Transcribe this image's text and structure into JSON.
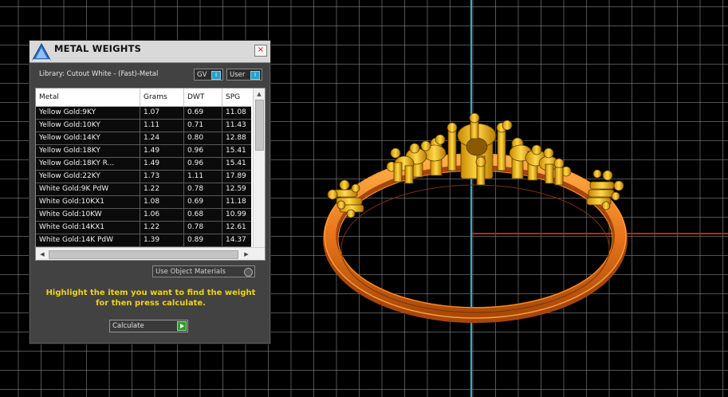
{
  "dialog": {
    "title": "METAL WEIGHTS",
    "close_glyph": "×",
    "library_label": "Library: Cutout White - (Fast)-Metal",
    "gv_label": "GV",
    "user_label": "User",
    "toggle_glyph": "I",
    "table": {
      "columns": [
        "Metal",
        "Grams",
        "DWT",
        "SPG"
      ],
      "rows": [
        [
          "Yellow Gold:9KY",
          "1.07",
          "0.69",
          "11.08"
        ],
        [
          "Yellow Gold:10KY",
          "1.11",
          "0.71",
          "11.43"
        ],
        [
          "Yellow Gold:14KY",
          "1.24",
          "0.80",
          "12.88"
        ],
        [
          "Yellow Gold:18KY",
          "1.49",
          "0.96",
          "15.41"
        ],
        [
          "Yellow Gold:18KY R...",
          "1.49",
          "0.96",
          "15.41"
        ],
        [
          "Yellow Gold:22KY",
          "1.73",
          "1.11",
          "17.89"
        ],
        [
          "White Gold:9K PdW",
          "1.22",
          "0.78",
          "12.59"
        ],
        [
          "White Gold:10KX1",
          "1.08",
          "0.69",
          "11.18"
        ],
        [
          "White Gold:10KW",
          "1.06",
          "0.68",
          "10.99"
        ],
        [
          "White Gold:14KX1",
          "1.22",
          "0.78",
          "12.61"
        ],
        [
          "White Gold:14K PdW",
          "1.39",
          "0.89",
          "14.37"
        ]
      ]
    },
    "scroll": {
      "up": "▲",
      "left": "◀",
      "right": "▶"
    },
    "use_object_materials_label": "Use Object Materials",
    "hint_line1": "Highlight the item you want to find the weight",
    "hint_line2": "for then press calculate.",
    "calculate_label": "Calculate"
  },
  "viewport": {
    "axis_colors": {
      "vertical": "#1fb5d6",
      "horizontal": "#c62020"
    },
    "model_colors": {
      "band": "#e8741a",
      "head": "#f5b800"
    }
  },
  "icons": [
    "app-logo-icon",
    "close-icon",
    "go-arrow-icon"
  ]
}
